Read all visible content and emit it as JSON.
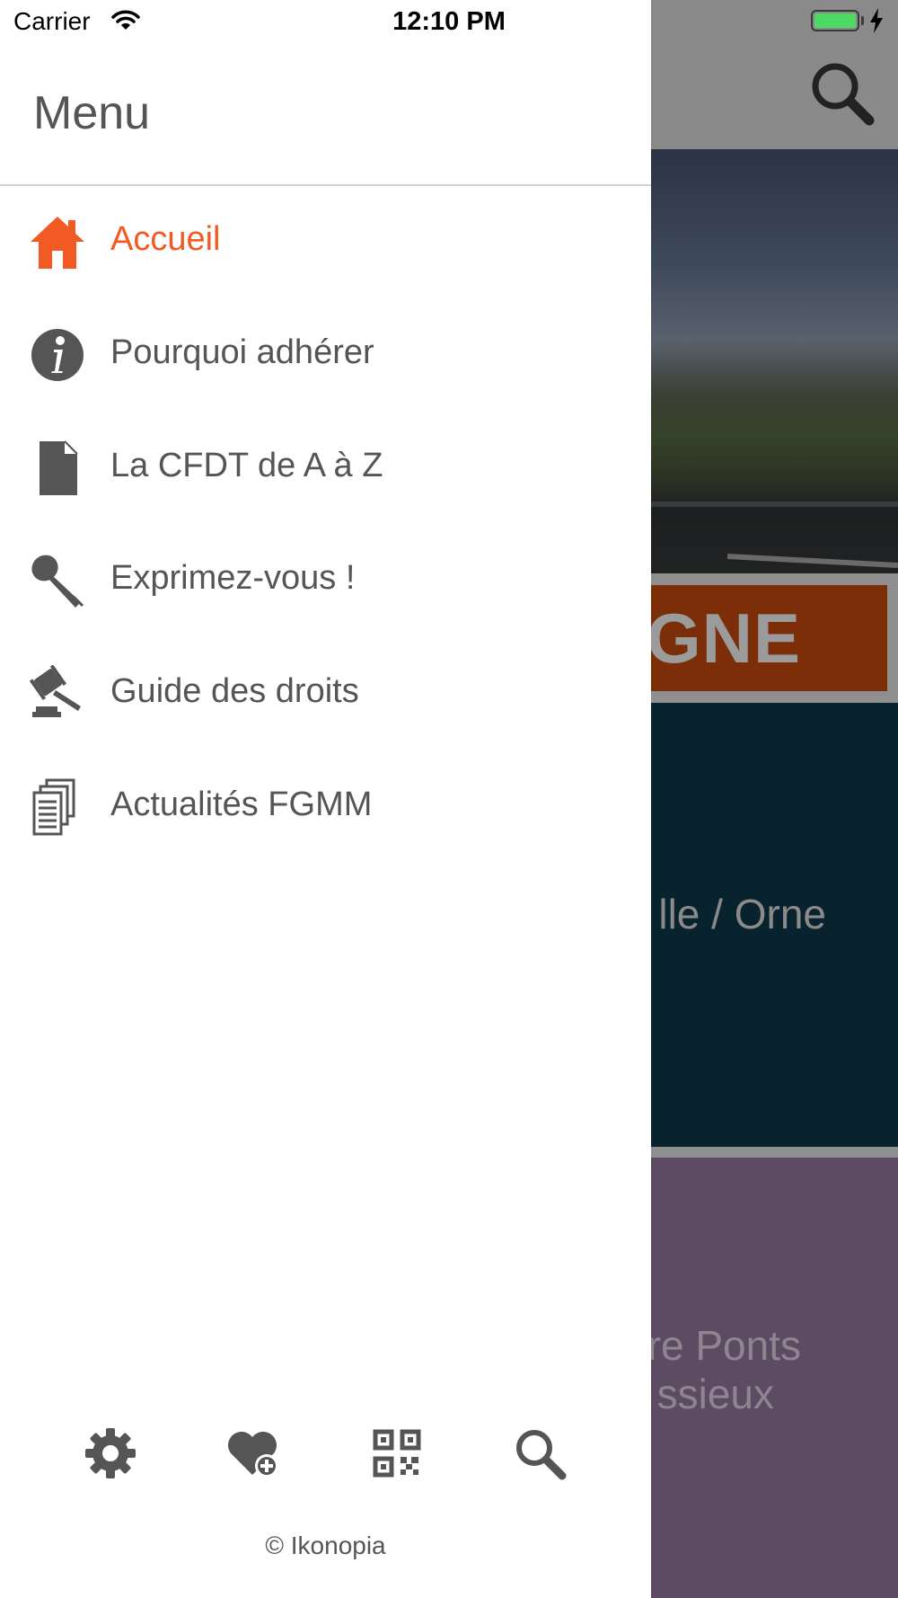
{
  "status_bar": {
    "carrier": "Carrier",
    "time": "12:10 PM",
    "battery_color": "#4cd964"
  },
  "background": {
    "banner_text": "GNE",
    "card1_text": "lle / Orne",
    "card2_line1": "re Ponts",
    "card2_line2": "ssieux",
    "search_icon": "search-icon"
  },
  "drawer": {
    "title": "Menu",
    "accent_color": "#f15a22",
    "items": [
      {
        "label": "Accueil",
        "icon": "home-icon",
        "active": true
      },
      {
        "label": "Pourquoi adhérer",
        "icon": "info-icon",
        "active": false
      },
      {
        "label": "La CFDT de A à Z",
        "icon": "document-icon",
        "active": false
      },
      {
        "label": "Exprimez-vous !",
        "icon": "microphone-icon",
        "active": false
      },
      {
        "label": "Guide des droits",
        "icon": "gavel-icon",
        "active": false
      },
      {
        "label": "Actualités FGMM",
        "icon": "newspaper-icon",
        "active": false
      }
    ],
    "bottom_icons": [
      "gear-icon",
      "heart-plus-icon",
      "qr-code-icon",
      "search-icon"
    ],
    "copyright": "© Ikonopia"
  }
}
